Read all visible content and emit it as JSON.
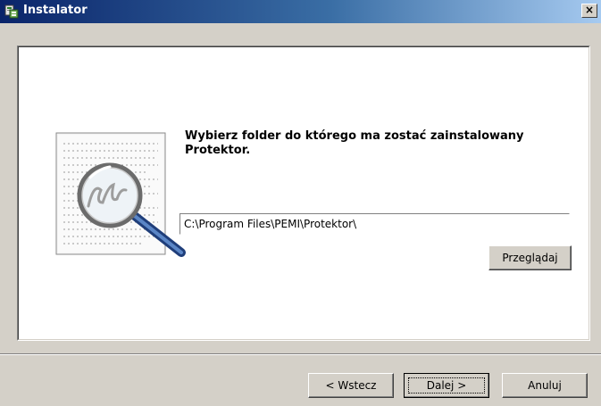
{
  "window": {
    "title": "Instalator",
    "close_label": "×"
  },
  "content": {
    "instruction": "Wybierz folder do którego ma zostać zainstalowany Protektor.",
    "path_value": "C:\\Program Files\\PEMI\\Protektor\\",
    "browse_label": "Przeglądaj"
  },
  "footer": {
    "back_label": "< Wstecz",
    "next_label": "Dalej >",
    "cancel_label": "Anuluj"
  },
  "colors": {
    "title_gradient_start": "#0a246a",
    "title_gradient_end": "#a6caf0",
    "face": "#d4d0c8"
  },
  "icons": {
    "app": "installer-icon",
    "illustration": "document-magnifier-icon"
  }
}
